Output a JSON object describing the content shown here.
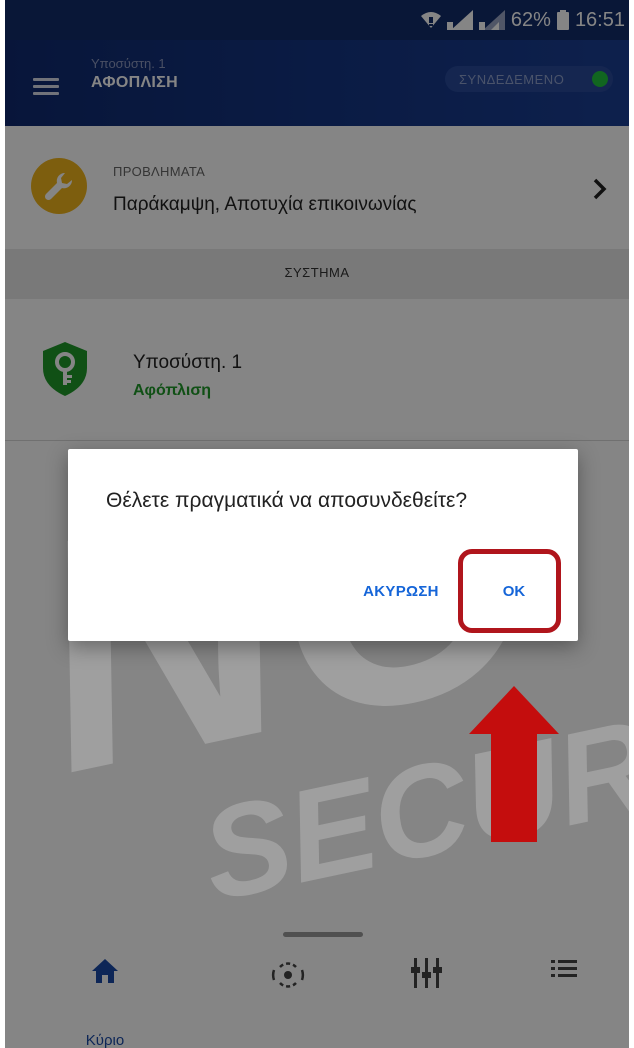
{
  "status_bar": {
    "battery": "62%",
    "time": "16:51",
    "icons": [
      "wifi-icon",
      "signal-icon",
      "signal-icon-2",
      "battery-icon"
    ]
  },
  "header": {
    "subtitle": "Υποσύστη. 1",
    "title": "ΑΦΟΠΛΙΣΗ",
    "connection_label": "ΣΥΝΔΕΔΕΜΕΝΟ",
    "connection_color": "#22c33e"
  },
  "problems": {
    "label": "ΠΡΟΒΛΗΜΑΤΑ",
    "value": "Παράκαμψη, Αποτυχία επικοινωνίας",
    "icon": "wrench-icon",
    "icon_color": "#f0b41c"
  },
  "section": {
    "title": "ΣΥΣΤΗΜΑ"
  },
  "partition": {
    "name": "Υποσύστη. 1",
    "status": "Αφόπλιση",
    "status_color": "#1f9a2a",
    "icon": "shield-key-icon"
  },
  "dialog": {
    "message": "Θέλετε πραγματικά να αποσυνδεθείτε?",
    "cancel_label": "ΑΚΥΡΩΣΗ",
    "ok_label": "OK"
  },
  "bottom_nav": {
    "items": [
      {
        "label": "Κύριο",
        "icon": "home-icon",
        "active": true
      },
      {
        "label": "",
        "icon": "sensor-icon",
        "active": false
      },
      {
        "label": "",
        "icon": "equalizer-icon",
        "active": false
      },
      {
        "label": "",
        "icon": "list-icon",
        "active": false
      }
    ]
  },
  "watermark": {
    "line1": "NO",
    "line2": "SECUR"
  },
  "annotation": {
    "highlight_color": "#b0151c"
  }
}
